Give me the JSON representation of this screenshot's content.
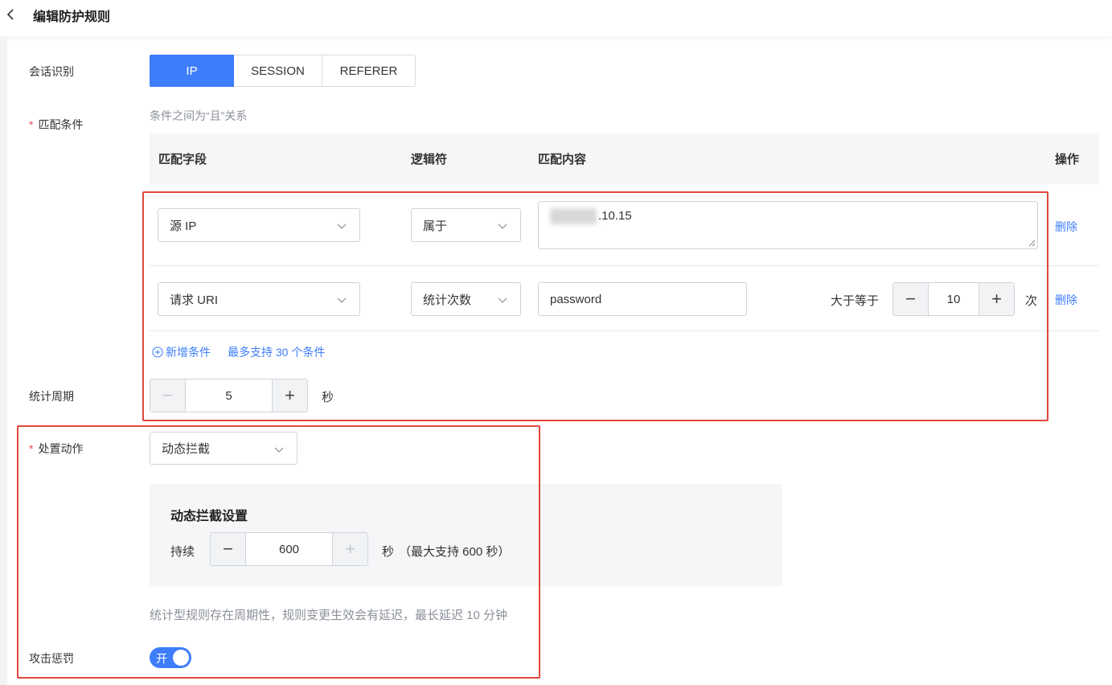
{
  "header": {
    "title": "编辑防护规则",
    "back_icon": "chevron-left-icon"
  },
  "session": {
    "label": "会话识别",
    "options": [
      "IP",
      "SESSION",
      "REFERER"
    ],
    "selected": "IP"
  },
  "match": {
    "required_mark": "*",
    "label": "匹配条件",
    "hint": "条件之间为“且”关系",
    "columns": {
      "field": "匹配字段",
      "logic": "逻辑符",
      "content": "匹配内容",
      "action": "操作"
    },
    "rows": [
      {
        "field": "源 IP",
        "logic": "属于",
        "content": ".10.15",
        "delete": "删除"
      },
      {
        "field": "请求 URI",
        "logic": "统计次数",
        "content": "password",
        "compare": "大于等于",
        "count": "10",
        "unit": "次",
        "delete": "删除"
      }
    ],
    "add_condition": "新增条件",
    "add_hint": "最多支持 30 个条件"
  },
  "period": {
    "label": "统计周期",
    "value": "5",
    "unit": "秒"
  },
  "action": {
    "required_mark": "*",
    "label": "处置动作",
    "selected": "动态拦截",
    "panel_title": "动态拦截设置",
    "duration_label": "持续",
    "duration_value": "600",
    "duration_unit": "秒",
    "duration_hint": "（最大支持 600 秒）",
    "note": "统计型规则存在周期性，规则变更生效会有延迟，最长延迟 10 分钟"
  },
  "punish": {
    "label": "攻击惩罚",
    "toggle_text": "开",
    "enabled": true
  },
  "colors": {
    "primary": "#3d7dfb",
    "highlight_box": "#e0473d",
    "required": "#e34d59"
  }
}
